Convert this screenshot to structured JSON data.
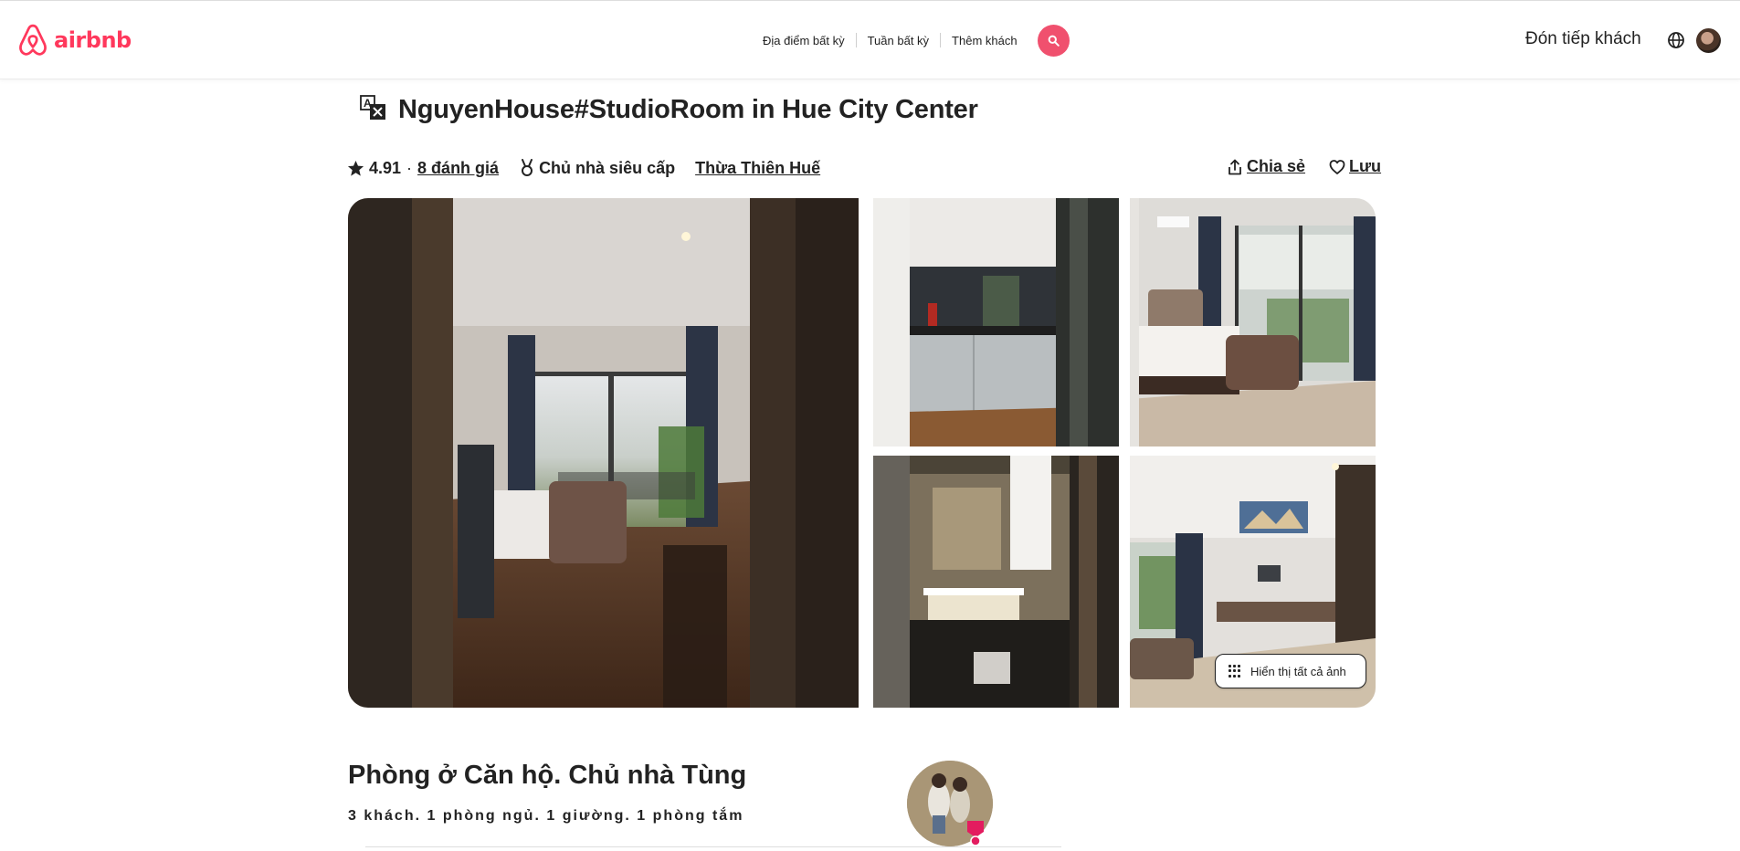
{
  "header": {
    "logo_text": "airbnb",
    "brand_color": "#FF385C",
    "search": {
      "location": "Địa điểm bất kỳ",
      "week": "Tuần bất kỳ",
      "guests": "Thêm khách"
    },
    "host_link": "Đón tiếp khách"
  },
  "listing": {
    "title": "NguyenHouse#StudioRoom in Hue City Center",
    "rating": "4.91",
    "separator": "·",
    "reviews": "8 đánh giá",
    "superhost": "Chủ nhà siêu cấp",
    "location": "Thừa Thiên Huế",
    "share": "Chia sẻ",
    "save": "Lưu"
  },
  "gallery": {
    "show_all": "Hiển thị tất cả ảnh",
    "photos": [
      "living-room-photo",
      "kitchen-photo",
      "bedroom-photo",
      "bathroom-photo",
      "lounge-photo"
    ]
  },
  "host_section": {
    "title": "Phòng ở Căn hộ. Chủ nhà Tùng",
    "details": "3 khách. 1 phòng ngủ. 1 giường. 1 phòng tắm"
  },
  "icons": {
    "logo": "airbnb-logo-icon",
    "search": "search-icon",
    "globe": "globe-icon",
    "translate": "translate-icon",
    "star": "star-icon",
    "medal": "superhost-medal-icon",
    "share": "share-icon",
    "heart": "heart-icon",
    "grid": "grid-icon"
  }
}
